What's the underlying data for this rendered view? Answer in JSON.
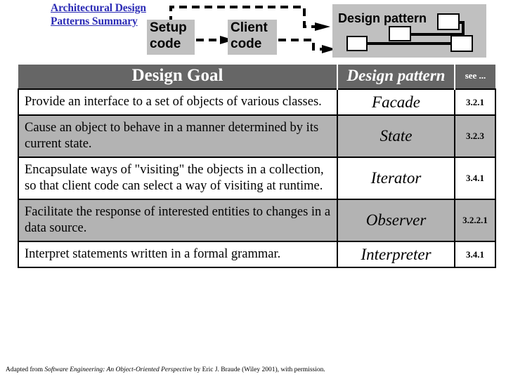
{
  "header": {
    "title_link": "Architectural Design Patterns Summary",
    "diagram": {
      "setup_box": "Setup code",
      "client_box": "Client code",
      "pattern_panel_label": "Design pattern",
      "node_count": 4
    }
  },
  "table": {
    "columns": [
      {
        "key": "goal",
        "label": "Design Goal"
      },
      {
        "key": "pattern",
        "label": "Design pattern"
      },
      {
        "key": "see",
        "label": "see ..."
      }
    ],
    "rows": [
      {
        "goal": "Provide an interface to a set of objects of various classes.",
        "pattern": "Facade",
        "see": "3.2.1",
        "shaded": false
      },
      {
        "goal": "Cause an object to behave in a manner determined by its current state.",
        "pattern": "State",
        "see": "3.2.3",
        "shaded": true
      },
      {
        "goal": "Encapsulate ways of \"visiting\" the objects in a collection, so that client code can select a way of visiting at runtime.",
        "pattern": "Iterator",
        "see": "3.4.1",
        "shaded": false
      },
      {
        "goal": "Facilitate the response of interested entities to changes in a data source.",
        "pattern": "Observer",
        "see": "3.2.2.1",
        "shaded": true
      },
      {
        "goal": "Interpret statements written in a formal grammar.",
        "pattern": "Interpreter",
        "see": "3.4.1",
        "shaded": false
      }
    ]
  },
  "footnote": {
    "prefix": "Adapted from ",
    "work_title": "Software Engineering: An Object-Oriented Perspective",
    "suffix": " by Eric J. Braude (Wiley 2001), with permission."
  },
  "colors": {
    "header_bar": "#666666",
    "row_shaded": "#b3b3b3",
    "diagram_gray": "#c0c0c0",
    "link_blue": "#2b2bb5",
    "text_black": "#000000",
    "white": "#ffffff"
  }
}
